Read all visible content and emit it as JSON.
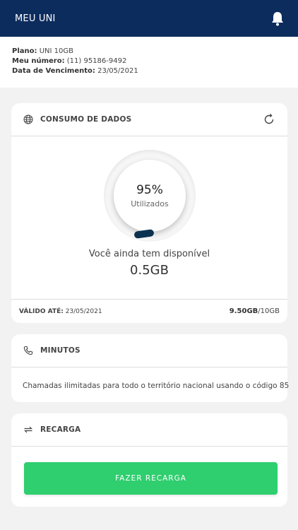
{
  "header": {
    "title": "MEU UNI",
    "bell_icon": "bell-icon"
  },
  "plan": {
    "plan_label": "Plano:",
    "plan_value": "UNI 10GB",
    "number_label": "Meu número:",
    "number_value": "(11) 95186-9492",
    "due_label": "Data de Vencimento:",
    "due_value": "23/05/2021"
  },
  "data_card": {
    "title": "CONSUMO DE DADOS",
    "globe_icon": "globe-icon",
    "refresh_icon": "refresh-icon",
    "percent_used": "95%",
    "percent_used_fraction": 0.95,
    "used_label": "Utilizados",
    "available_label": "Você ainda tem disponível",
    "available_value": "0.5GB",
    "valid_label": "VÁLIDO ATÉ:",
    "valid_value": "23/05/2021",
    "usage_used": "9.50GB",
    "usage_total": "/10GB"
  },
  "minutes_card": {
    "title": "MINUTOS",
    "phone_icon": "phone-icon",
    "description": "Chamadas ilimitadas para todo o território nacional usando o código 85"
  },
  "recharge_card": {
    "title": "RECARGA",
    "recharge_icon": "swap-arrows-icon",
    "button_label": "FAZER RECARGA"
  },
  "colors": {
    "header_bg": "#0d2c5e",
    "button_green": "#2fce6e",
    "page_bg": "#f2f2f2"
  }
}
